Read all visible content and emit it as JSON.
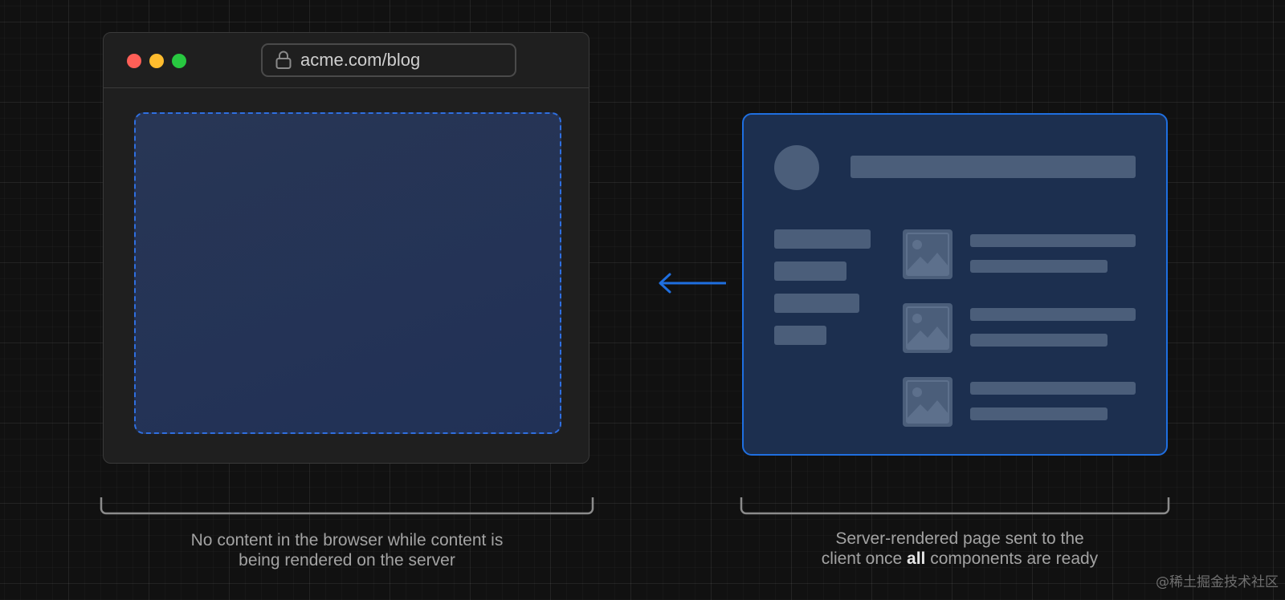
{
  "browser": {
    "url": "acme.com/blog",
    "lock_icon": "lock-icon",
    "traffic_lights": [
      "#ff5f57",
      "#febc2e",
      "#28c840"
    ],
    "placeholder_state": "empty"
  },
  "rendered_page": {
    "image_icon": "image-icon",
    "media_items_count": 3
  },
  "arrow": {
    "direction": "left",
    "color": "#1f6fe0"
  },
  "captions": {
    "left": {
      "line1": "No content in the browser while content is",
      "line2": "being rendered on the server"
    },
    "right": {
      "line1": "Server-rendered page sent to the",
      "line2_before": "client once ",
      "line2_bold": "all",
      "line2_after": " components are ready"
    }
  },
  "watermark": "@稀土掘金技术社区",
  "colors": {
    "background": "#111111",
    "accent_blue": "#1f6fe0",
    "skeleton": "#4b5e7a"
  }
}
